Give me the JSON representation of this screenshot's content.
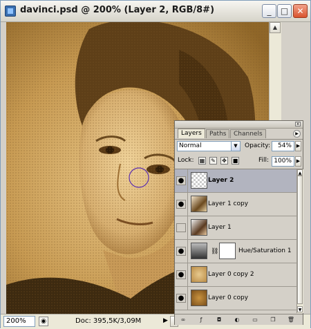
{
  "window": {
    "title": "davinci.psd @ 200% (Layer 2, RGB/8#)",
    "minimize_label": "_",
    "maximize_label": "□",
    "close_label": "✕"
  },
  "status": {
    "zoom": "200%",
    "doc_info": "Doc: 395,5K/3,09M",
    "arrow": "▶"
  },
  "layers_panel": {
    "tabs": [
      {
        "label": "Layers",
        "active": true
      },
      {
        "label": "Paths",
        "active": false
      },
      {
        "label": "Channels",
        "active": false
      }
    ],
    "blend_mode": "Normal",
    "opacity_label": "Opacity:",
    "opacity_value": "54%",
    "lock_label": "Lock:",
    "fill_label": "Fill:",
    "fill_value": "100%",
    "layers": [
      {
        "name": "Layer 2",
        "visible": true,
        "selected": true
      },
      {
        "name": "Layer 1 copy",
        "visible": true,
        "selected": false
      },
      {
        "name": "Layer 1",
        "visible": false,
        "selected": false
      },
      {
        "name": "Hue/Saturation 1",
        "visible": true,
        "selected": false,
        "adjustment": true
      },
      {
        "name": "Layer 0 copy 2",
        "visible": true,
        "selected": false
      },
      {
        "name": "Layer 0 copy",
        "visible": true,
        "selected": false
      }
    ]
  },
  "colors": {
    "sepia_light": "#e8c98a",
    "sepia_dark": "#6b4a1f",
    "selection_row": "#b2b4bf",
    "brush_cursor": "#5b2fb0"
  }
}
